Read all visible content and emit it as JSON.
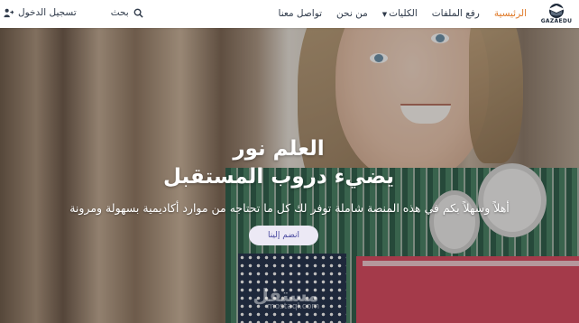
{
  "nav": {
    "logo_text": "GAZAEDU",
    "links": [
      {
        "label": "الرئيسية",
        "active": true
      },
      {
        "label": "رفع الملفات",
        "active": false
      },
      {
        "label": "الكليات",
        "active": false,
        "dropdown": true
      },
      {
        "label": "من نحن",
        "active": false
      },
      {
        "label": "تواصل معنا",
        "active": false
      }
    ],
    "search_label": "بحث",
    "login_label": "تسجيل الدخول",
    "active_color": "#e07b2a"
  },
  "hero": {
    "title_line1": "العلم نور",
    "title_line2": "يضيء دروب المستقبل",
    "subtitle": "أهلاً وسهلاً بكم في هذه المنصة شاملة توفر لك كل ما تحتاجه من موارد أكاديمية بسهولة ومرونة",
    "join_button": "انضم إلينا",
    "watermark": "مستقل",
    "watermark_sub": "mostaql.com"
  }
}
